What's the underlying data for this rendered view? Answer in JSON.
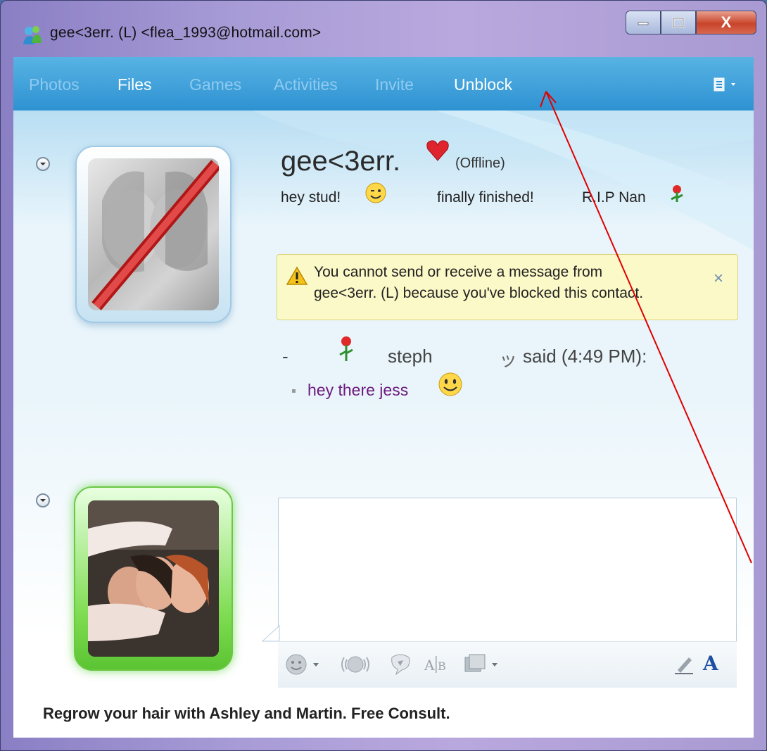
{
  "window": {
    "title": "gee<3err.  (L) <flea_1993@hotmail.com>",
    "controls": {
      "minimize": "minimize",
      "maximize": "maximize",
      "close": "X"
    }
  },
  "toolbar": {
    "items": [
      {
        "label": "Photos",
        "active": false
      },
      {
        "label": "Files",
        "active": true
      },
      {
        "label": "Games",
        "active": false
      },
      {
        "label": "Activities",
        "active": false
      },
      {
        "label": "Invite",
        "active": false
      },
      {
        "label": "Unblock",
        "active": true
      }
    ],
    "menu_icon": "layout-menu-icon"
  },
  "contact": {
    "name": "gee<3err.",
    "status": "(Offline)",
    "personal_message": [
      "hey stud!",
      "finally finished!",
      "R.I.P Nan"
    ]
  },
  "warning": {
    "line1": "You cannot send or receive a message from",
    "line2": "gee<3err.  (L) because you've blocked this contact.",
    "close": "×"
  },
  "conversation": {
    "dash": "-",
    "sender": "steph",
    "sender_suffix": "ッ",
    "said": "said (4:49 PM):",
    "message": "hey there jess"
  },
  "compose": {
    "icons": [
      "emoticon-icon",
      "nudge-icon",
      "wink-icon",
      "font-size-icon",
      "background-icon",
      "handwriting-icon",
      "font-icon"
    ],
    "font_label": "A"
  },
  "ad": {
    "text": "Regrow your hair with Ashley and Martin. Free Consult."
  },
  "colors": {
    "toolbar": "#3a9bd8",
    "warning_bg": "#fcf9c8",
    "message_text": "#6b1a7e",
    "annotation_arrow": "#e00000"
  }
}
